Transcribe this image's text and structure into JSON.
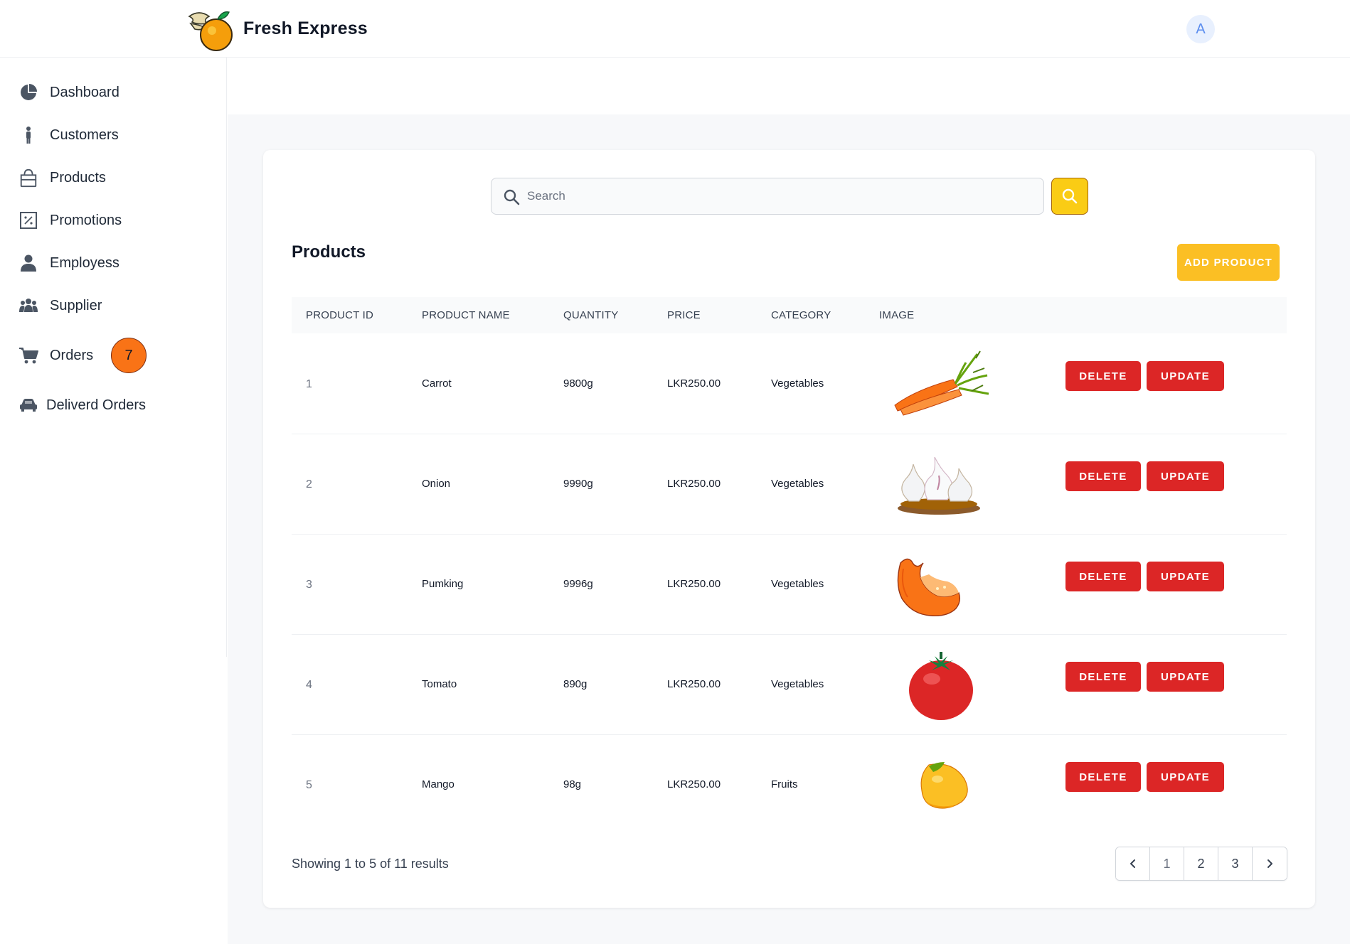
{
  "header": {
    "brand_name": "Fresh Express",
    "avatar_initial": "A"
  },
  "sidebar": {
    "items": [
      {
        "label": "Dashboard",
        "icon": "pie-chart-icon"
      },
      {
        "label": "Customers",
        "icon": "person-standing-icon"
      },
      {
        "label": "Products",
        "icon": "shopping-bag-icon"
      },
      {
        "label": "Promotions",
        "icon": "percent-icon"
      },
      {
        "label": "Employess",
        "icon": "user-icon"
      },
      {
        "label": "Supplier",
        "icon": "users-group-icon"
      },
      {
        "label": "Orders",
        "icon": "cart-icon",
        "badge": "7"
      },
      {
        "label": "Deliverd Orders",
        "icon": "car-icon"
      }
    ]
  },
  "search": {
    "placeholder": "Search",
    "value": ""
  },
  "products": {
    "title": "Products",
    "add_label": "ADD PRODUCT",
    "columns": [
      "PRODUCT ID",
      "PRODUCT NAME",
      "QUANTITY",
      "PRICE",
      "CATEGORY",
      "IMAGE"
    ],
    "rows": [
      {
        "id": "1",
        "name": "Carrot",
        "quantity": "9800g",
        "price": "LKR250.00",
        "category": "Vegetables",
        "image": "carrot"
      },
      {
        "id": "2",
        "name": "Onion",
        "quantity": "9990g",
        "price": "LKR250.00",
        "category": "Vegetables",
        "image": "garlic"
      },
      {
        "id": "3",
        "name": "Pumking",
        "quantity": "9996g",
        "price": "LKR250.00",
        "category": "Vegetables",
        "image": "pumpkin"
      },
      {
        "id": "4",
        "name": "Tomato",
        "quantity": "890g",
        "price": "LKR250.00",
        "category": "Vegetables",
        "image": "tomato"
      },
      {
        "id": "5",
        "name": "Mango",
        "quantity": "98g",
        "price": "LKR250.00",
        "category": "Fruits",
        "image": "mango"
      }
    ],
    "delete_label": "DELETE",
    "update_label": "UPDATE"
  },
  "pagination": {
    "summary": "Showing 1 to 5 of 11 results",
    "pages": [
      "1",
      "2",
      "3"
    ],
    "current_page": "1"
  },
  "colors": {
    "accent_yellow": "#fbbf24",
    "danger_red": "#dc2626",
    "badge_orange": "#f97316"
  }
}
